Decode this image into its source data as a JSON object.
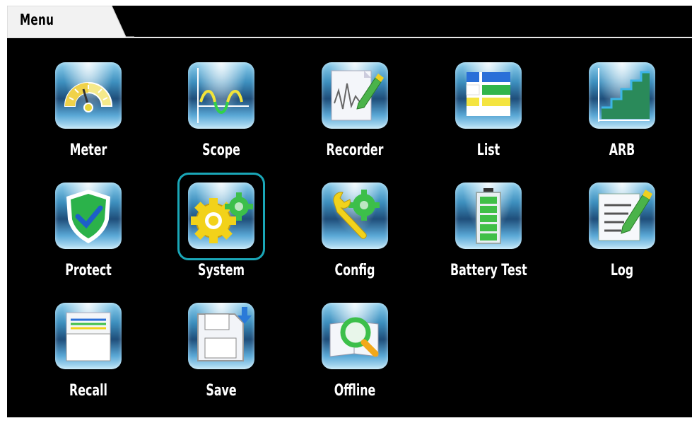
{
  "header": {
    "title": "Menu"
  },
  "menu": {
    "items": [
      {
        "label": "Meter",
        "icon": "meter-gauge-icon"
      },
      {
        "label": "Scope",
        "icon": "scope-waveform-icon"
      },
      {
        "label": "Recorder",
        "icon": "recorder-chart-icon"
      },
      {
        "label": "List",
        "icon": "list-table-icon"
      },
      {
        "label": "ARB",
        "icon": "arb-staircase-icon"
      },
      {
        "label": "Protect",
        "icon": "shield-check-icon"
      },
      {
        "label": "System",
        "icon": "system-gears-icon"
      },
      {
        "label": "Config",
        "icon": "config-wrench-icon"
      },
      {
        "label": "Battery Test",
        "icon": "battery-icon"
      },
      {
        "label": "Log",
        "icon": "log-notepad-icon"
      },
      {
        "label": "Recall",
        "icon": "recall-tray-icon"
      },
      {
        "label": "Save",
        "icon": "save-floppy-icon"
      },
      {
        "label": "Offline",
        "icon": "offline-magnifier-icon"
      }
    ],
    "selected": "System"
  },
  "colors": {
    "background": "#000000",
    "selection_ring": "#1aa7b8",
    "tile_blue": "#3d8fbe",
    "label": "#ffffff"
  }
}
